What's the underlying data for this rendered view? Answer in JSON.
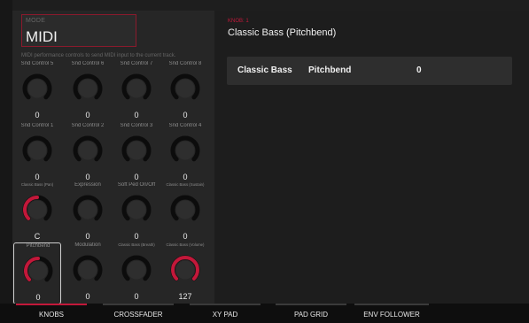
{
  "mode": {
    "label": "MODE",
    "value": "MIDI",
    "description": "MIDI performance controls to send MIDI input to the current track."
  },
  "knobs": [
    {
      "label": "Snd Control 5",
      "value": "0",
      "level": 0
    },
    {
      "label": "Snd Control 6",
      "value": "0",
      "level": 0
    },
    {
      "label": "Snd Control 7",
      "value": "0",
      "level": 0
    },
    {
      "label": "Snd Control 8",
      "value": "0",
      "level": 0
    },
    {
      "label": "Snd Control 1",
      "value": "0",
      "level": 0
    },
    {
      "label": "Snd Control 2",
      "value": "0",
      "level": 0
    },
    {
      "label": "Snd Control 3",
      "value": "0",
      "level": 0
    },
    {
      "label": "Snd Control 4",
      "value": "0",
      "level": 0
    },
    {
      "label": "Classic Bass (Pan)",
      "value": "C",
      "level": 0.5
    },
    {
      "label": "Expression",
      "value": "0",
      "level": 0
    },
    {
      "label": "Soft Ped On/Off",
      "value": "0",
      "level": 0
    },
    {
      "label": "Classic Bass (Sustain)",
      "value": "0",
      "level": 0
    },
    {
      "label": "Pitchbend",
      "value": "0",
      "level": 0.5
    },
    {
      "label": "Modulation",
      "value": "0",
      "level": 0
    },
    {
      "label": "Classic Bass (Breath)",
      "value": "0",
      "level": 0
    },
    {
      "label": "Classic Bass (Volume)",
      "value": "127",
      "level": 1
    }
  ],
  "detail": {
    "knob_id": "KNOB: 1",
    "title": "Classic Bass (Pitchbend)",
    "row": {
      "instrument": "Classic Bass",
      "parameter": "Pitchbend",
      "value": "0"
    }
  },
  "tabs": [
    {
      "label": "KNOBS",
      "active": true
    },
    {
      "label": "CROSSFADER",
      "active": false
    },
    {
      "label": "XY PAD",
      "active": false
    },
    {
      "label": "PAD GRID",
      "active": false
    },
    {
      "label": "ENV FOLLOWER",
      "active": false
    }
  ],
  "colors": {
    "accent": "#c2183a",
    "knob_track": "#0c0c0c",
    "knob_face": "#2e2e2e"
  }
}
